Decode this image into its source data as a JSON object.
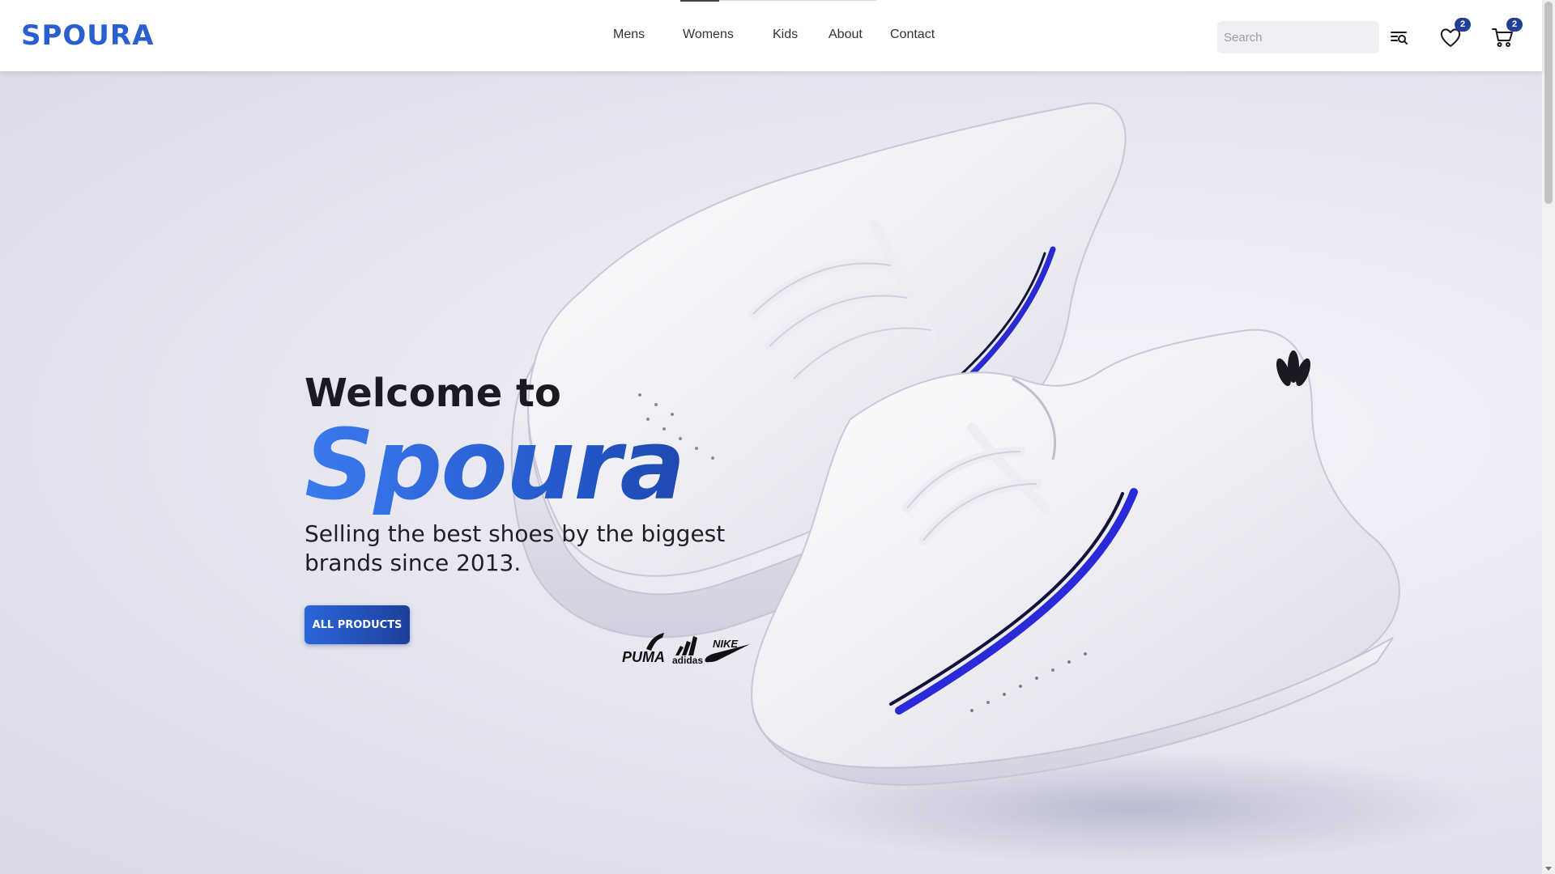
{
  "header": {
    "logo": "SPOURA",
    "nav": [
      {
        "label": "Mens"
      },
      {
        "label": "Womens"
      },
      {
        "label": "Kids"
      },
      {
        "label": "About"
      },
      {
        "label": "Contact"
      }
    ],
    "search": {
      "placeholder": "Search",
      "value": ""
    },
    "icons": {
      "search": "search-filter-icon",
      "wishlist": "heart-icon",
      "cart": "cart-icon"
    },
    "wishlist_count": "2",
    "cart_count": "2"
  },
  "hero": {
    "welcome": "Welcome to",
    "brand": "Spoura",
    "tagline": "Selling the best shoes by the biggest brands since 2013.",
    "cta_label": "ALL PRODUCTS",
    "brand_logos": [
      "PUMA",
      "adidas",
      "NIKE"
    ]
  },
  "colors": {
    "brand_blue": "#2b5fcf",
    "badge_blue": "#1f3f9a",
    "text_dark": "#1a1a22"
  }
}
